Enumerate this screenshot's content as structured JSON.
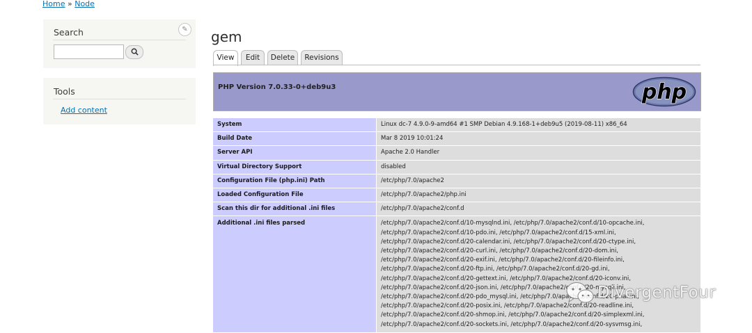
{
  "breadcrumb": {
    "home": "Home",
    "separator": "»",
    "current": "Node"
  },
  "search_block": {
    "title": "Search",
    "input_value": "",
    "button_icon": "search-icon"
  },
  "tools_block": {
    "title": "Tools",
    "link": "Add content"
  },
  "page": {
    "title": "gem"
  },
  "tabs": [
    {
      "label": "View",
      "active": true
    },
    {
      "label": "Edit",
      "active": false
    },
    {
      "label": "Delete",
      "active": false
    },
    {
      "label": "Revisions",
      "active": false
    }
  ],
  "php": {
    "version": "PHP Version 7.0.33-0+deb9u3",
    "logo_text": "php",
    "rows": [
      {
        "key": "System",
        "value": "Linux dc-7 4.9.0-9-amd64 #1 SMP Debian 4.9.168-1+deb9u5 (2019-08-11) x86_64"
      },
      {
        "key": "Build Date",
        "value": "Mar 8 2019 10:01:24"
      },
      {
        "key": "Server API",
        "value": "Apache 2.0 Handler"
      },
      {
        "key": "Virtual Directory Support",
        "value": "disabled"
      },
      {
        "key": "Configuration File (php.ini) Path",
        "value": "/etc/php/7.0/apache2"
      },
      {
        "key": "Loaded Configuration File",
        "value": "/etc/php/7.0/apache2/php.ini"
      },
      {
        "key": "Scan this dir for additional .ini files",
        "value": "/etc/php/7.0/apache2/conf.d"
      }
    ],
    "ini_key": "Additional .ini files parsed",
    "ini_lines": [
      "/etc/php/7.0/apache2/conf.d/10-mysqlnd.ini, /etc/php/7.0/apache2/conf.d/10-opcache.ini,",
      "/etc/php/7.0/apache2/conf.d/10-pdo.ini, /etc/php/7.0/apache2/conf.d/15-xml.ini,",
      "/etc/php/7.0/apache2/conf.d/20-calendar.ini, /etc/php/7.0/apache2/conf.d/20-ctype.ini,",
      "/etc/php/7.0/apache2/conf.d/20-curl.ini, /etc/php/7.0/apache2/conf.d/20-dom.ini,",
      "/etc/php/7.0/apache2/conf.d/20-exif.ini, /etc/php/7.0/apache2/conf.d/20-fileinfo.ini,",
      "/etc/php/7.0/apache2/conf.d/20-ftp.ini, /etc/php/7.0/apache2/conf.d/20-gd.ini,",
      "/etc/php/7.0/apache2/conf.d/20-gettext.ini, /etc/php/7.0/apache2/conf.d/20-iconv.ini,",
      "/etc/php/7.0/apache2/conf.d/20-json.ini, /etc/php/7.0/apache2/conf.d/20-mysqli.ini,",
      "/etc/php/7.0/apache2/conf.d/20-pdo_mysql.ini, /etc/php/7.0/apache2/conf.d/20-phar.ini,",
      "/etc/php/7.0/apache2/conf.d/20-posix.ini, /etc/php/7.0/apache2/conf.d/20-readline.ini,",
      "/etc/php/7.0/apache2/conf.d/20-shmop.ini, /etc/php/7.0/apache2/conf.d/20-simplexml.ini,",
      "/etc/php/7.0/apache2/conf.d/20-sockets.ini, /etc/php/7.0/apache2/conf.d/20-sysvmsg.ini,"
    ]
  },
  "watermark": {
    "text": "DivergentFour",
    "icon": "wechat-icon"
  },
  "colors": {
    "php_header": "#9999cc",
    "key_cell": "#ccccff",
    "value_cell": "#dddddd",
    "link": "#0071b3"
  }
}
